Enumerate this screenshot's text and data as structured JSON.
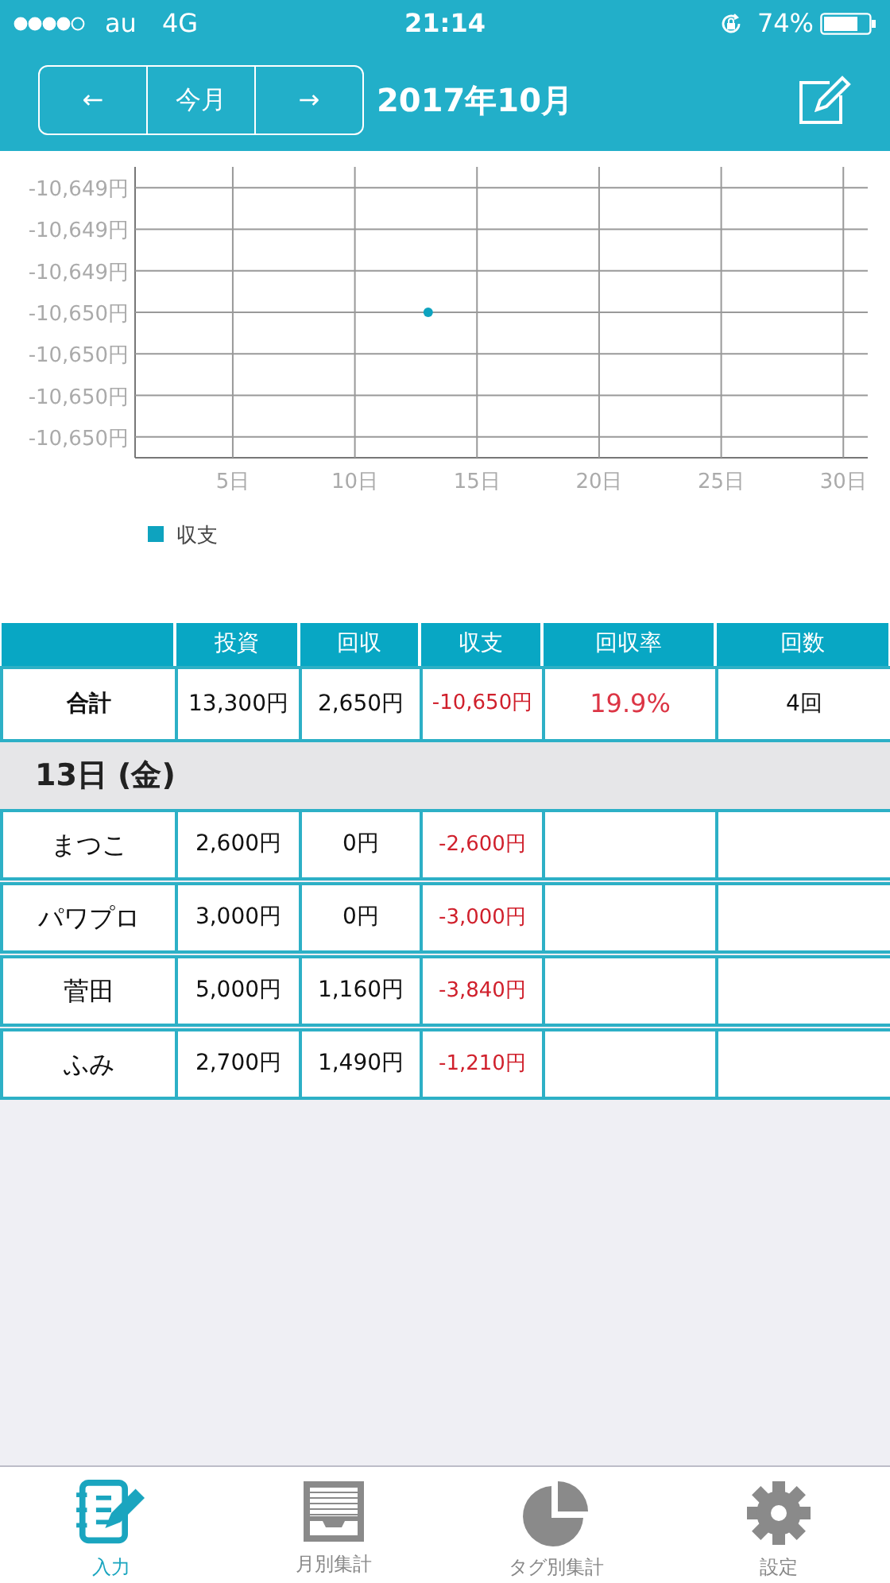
{
  "status_bar": {
    "carrier": "au",
    "network": "4G",
    "time": "21:14",
    "battery": "74%"
  },
  "header": {
    "prev": "←",
    "today": "今月",
    "next": "→",
    "title": "2017年10月"
  },
  "chart": {
    "chart_data": {
      "type": "scatter",
      "grid": true,
      "xlim": [
        1,
        31
      ],
      "ylim": [
        -10650.035,
        -10648.985
      ],
      "xticks": [
        {
          "value": 5,
          "label": "5日"
        },
        {
          "value": 10,
          "label": "10日"
        },
        {
          "value": 15,
          "label": "15日"
        },
        {
          "value": 20,
          "label": "20日"
        },
        {
          "value": 25,
          "label": "25日"
        },
        {
          "value": 30,
          "label": "30日"
        }
      ],
      "yticks": [
        {
          "value": -10649.06,
          "label": "-10,649円"
        },
        {
          "value": -10649.21,
          "label": "-10,649円"
        },
        {
          "value": -10649.36,
          "label": "-10,649円"
        },
        {
          "value": -10649.51,
          "label": "-10,650円"
        },
        {
          "value": -10649.66,
          "label": "-10,650円"
        },
        {
          "value": -10649.81,
          "label": "-10,650円"
        },
        {
          "value": -10649.96,
          "label": "-10,650円"
        }
      ],
      "x": [
        13
      ],
      "series": [
        {
          "name": "収支",
          "color": "#0ea3bf",
          "values": [
            -10649.51
          ]
        }
      ]
    }
  },
  "table": {
    "columns": [
      "投資",
      "回収",
      "収支",
      "回収率",
      "回数"
    ],
    "total": {
      "label": "合計",
      "invest": "13,300円",
      "returned": "2,650円",
      "balance": "-10,650円",
      "rate": "19.9%",
      "count": "4回"
    },
    "day": "13日 (金)",
    "rows": [
      {
        "name": "まつこ",
        "invest": "2,600円",
        "returned": "0円",
        "balance": "-2,600円"
      },
      {
        "name": "パワプロ",
        "invest": "3,000円",
        "returned": "0円",
        "balance": "-3,000円"
      },
      {
        "name": "菅田",
        "invest": "5,000円",
        "returned": "1,160円",
        "balance": "-3,840円"
      },
      {
        "name": "ふみ",
        "invest": "2,700円",
        "returned": "1,490円",
        "balance": "-1,210円"
      }
    ]
  },
  "tabs": [
    {
      "label": "入力",
      "kind": "input",
      "selected": true
    },
    {
      "label": "月別集計",
      "kind": "monthly",
      "selected": false
    },
    {
      "label": "タグ別集計",
      "kind": "tag",
      "selected": false
    },
    {
      "label": "設定",
      "kind": "settings",
      "selected": false
    }
  ]
}
